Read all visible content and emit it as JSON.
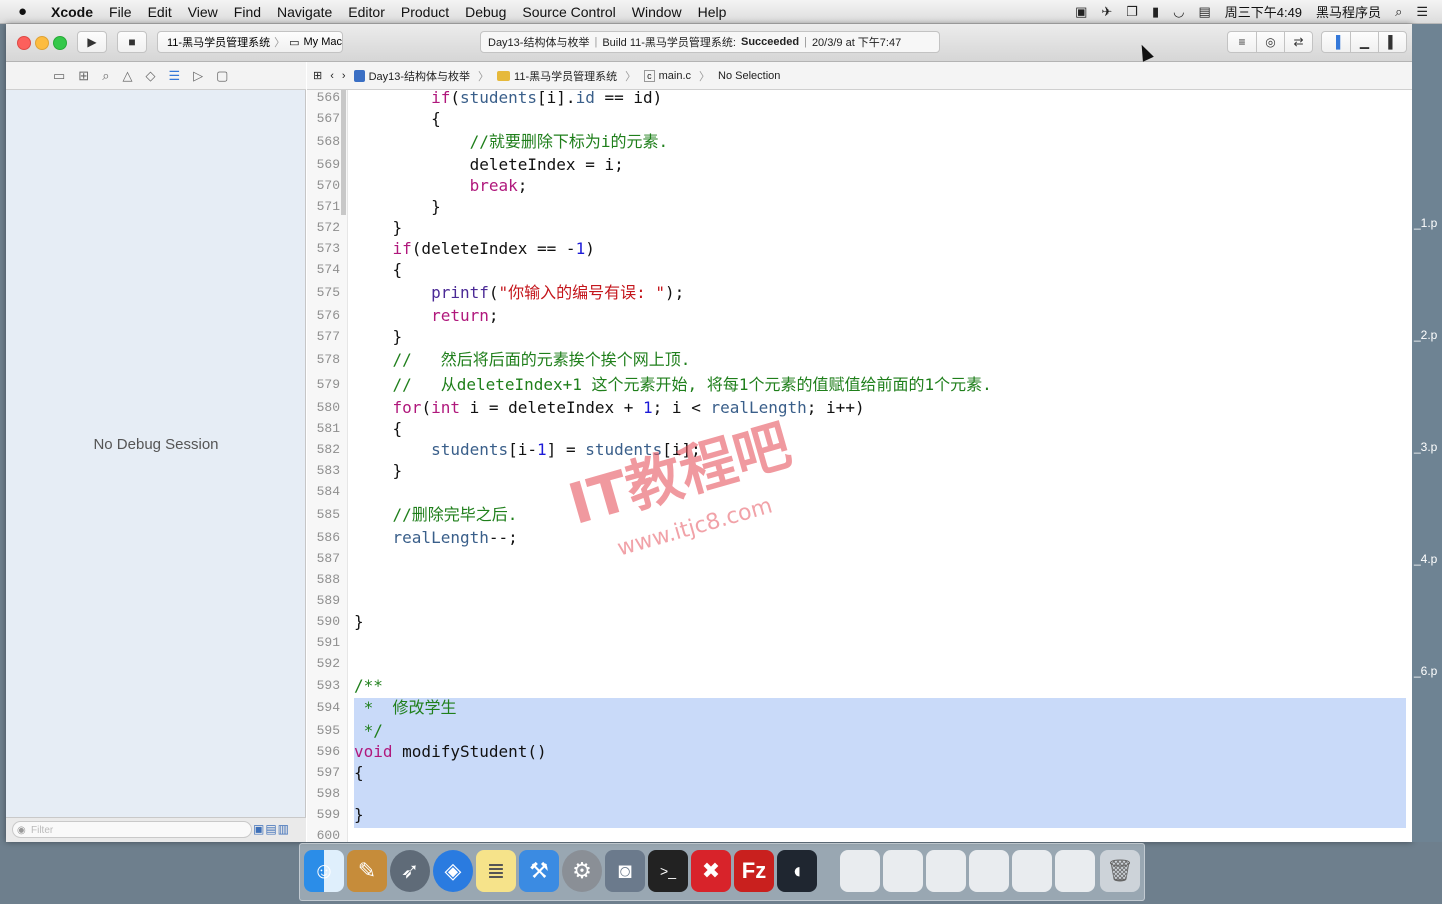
{
  "menubar": {
    "app": "Xcode",
    "items": [
      "File",
      "Edit",
      "View",
      "Find",
      "Navigate",
      "Editor",
      "Product",
      "Debug",
      "Source Control",
      "Window",
      "Help"
    ],
    "clock": "周三下午4:49",
    "user": "黑马程序员"
  },
  "toolbar": {
    "scheme_target": "11-黑马学员管理系统",
    "scheme_device": "My Mac",
    "activity_project": "Day13-结构体与枚举",
    "activity_status_prefix": "Build 11-黑马学员管理系统:",
    "activity_status": "Succeeded",
    "activity_time": "20/3/9 at 下午7:47"
  },
  "navigator": {
    "empty_message": "No Debug Session",
    "filter_placeholder": "Filter"
  },
  "jumpbar": {
    "project": "Day13-结构体与枚举",
    "group": "11-黑马学员管理系统",
    "file": "main.c",
    "selection": "No Selection"
  },
  "editor": {
    "line_numbers": [
      "566",
      "567",
      "568",
      "569",
      "570",
      "571",
      "572",
      "573",
      "574",
      "575",
      "576",
      "577",
      "578",
      "579",
      "580",
      "581",
      "582",
      "583",
      "584",
      "585",
      "586",
      "587",
      "588",
      "589",
      "590",
      "591",
      "592",
      "593",
      "594",
      "595",
      "596",
      "597",
      "598",
      "599",
      "600"
    ]
  },
  "right_labels": [
    "_1.p",
    "_2.p",
    "_3.p",
    "_4.p",
    "_6.p"
  ],
  "watermark": {
    "title": "IT教程吧",
    "url": "www.itjc8.com"
  },
  "dock": {
    "icons": [
      "finder-icon",
      "scripteditor-icon",
      "launchpad-icon",
      "safari-icon",
      "notes-icon",
      "xcode-icon",
      "sysprefs-icon",
      "imagecapture-icon",
      "terminal-icon",
      "xmind-icon",
      "filezilla-icon",
      "mouse-icon",
      "window-thumb-1",
      "window-thumb-2",
      "window-thumb-3",
      "window-thumb-4",
      "window-thumb-5",
      "window-thumb-6",
      "trash-icon"
    ]
  }
}
